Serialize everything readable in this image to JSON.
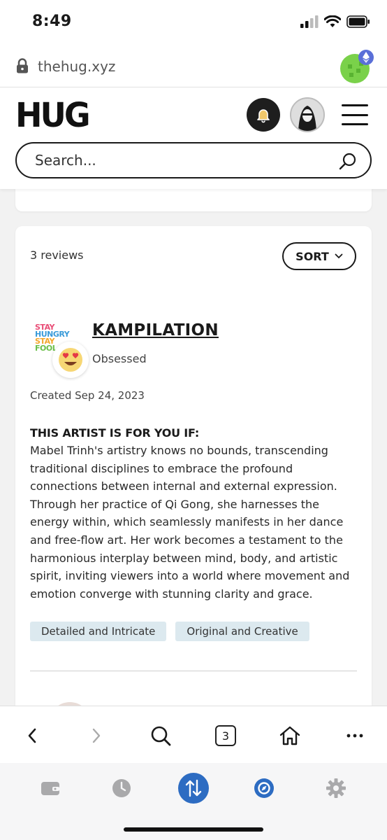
{
  "status_bar": {
    "time": "8:49"
  },
  "browser": {
    "url": "thehug.xyz",
    "tab_count": "3"
  },
  "header": {
    "logo": "HUG"
  },
  "search": {
    "placeholder": "Search..."
  },
  "reviews": {
    "count_label": "3 reviews",
    "sort_label": "SORT",
    "review": {
      "reviewer_logo_lines": [
        "STAY",
        "HUNGRY",
        "STAY",
        "FOOL"
      ],
      "reviewer_name": "KAMPILATION",
      "reviewer_status": "Obsessed",
      "created": "Created Sep 24, 2023",
      "heading": "THIS ARTIST IS FOR YOU IF:",
      "body": "Mabel Trinh's artistry knows no bounds, transcending traditional disciplines to embrace the profound connections between internal and external expression. Through her practice of Qi Gong, she harnesses the energy within, which seamlessly manifests in her dance and free-flow art. Her work becomes a testament to the harmonious interplay between mind, body, and artistic spirit, inviting viewers into a world where movement and emotion converge with stunning clarity and grace.",
      "tags": [
        "Detailed and Intricate",
        "Original and Creative"
      ]
    }
  },
  "colors": {
    "accent_blue": "#2d6cc2",
    "tag_bg": "#dce9ef",
    "dark": "#1a1a1a"
  }
}
